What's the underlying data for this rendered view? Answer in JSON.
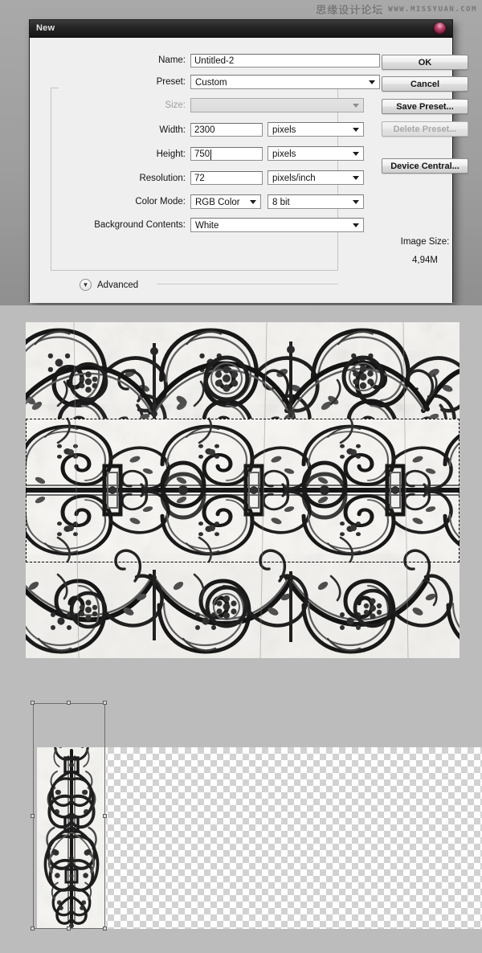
{
  "watermark": {
    "chinese": "思缘设计论坛",
    "url": "WWW.MISSYUAN.COM"
  },
  "dialog": {
    "title": "New",
    "close_icon": "close-circle-icon",
    "fields": {
      "name": {
        "label": "Name:",
        "value": "Untitled-2"
      },
      "preset": {
        "label": "Preset:",
        "value": "Custom"
      },
      "size": {
        "label": "Size:",
        "value": "",
        "disabled": true
      },
      "width": {
        "label": "Width:",
        "value": "2300",
        "unit": "pixels"
      },
      "height": {
        "label": "Height:",
        "value": "750",
        "unit": "pixels"
      },
      "resolution": {
        "label": "Resolution:",
        "value": "72",
        "unit": "pixels/inch"
      },
      "color_mode": {
        "label": "Color Mode:",
        "value": "RGB Color",
        "depth": "8 bit"
      },
      "background_contents": {
        "label": "Background Contents:",
        "value": "White"
      }
    },
    "buttons": {
      "ok": "OK",
      "cancel": "Cancel",
      "save_preset": "Save Preset...",
      "delete_preset": "Delete Preset...",
      "device_central": "Device Central..."
    },
    "image_size": {
      "label": "Image Size:",
      "value": "4,94M"
    },
    "advanced": {
      "label": "Advanced",
      "disclosure_icon": "chevron-double-down-icon",
      "expanded": false
    }
  },
  "canvas_middle": {
    "description": "ornamental-scrollwork-texture",
    "selection": "dashed-marquee"
  },
  "canvas_bottom": {
    "description": "pasted-ornament-on-transparency",
    "transform_box": "free-transform-bounding-box"
  },
  "colors": {
    "dialog_bg": "#efeff0",
    "titlebar": "#1c1c1c",
    "close_button": "#8e2244",
    "workspace": "#bcbcbc"
  }
}
